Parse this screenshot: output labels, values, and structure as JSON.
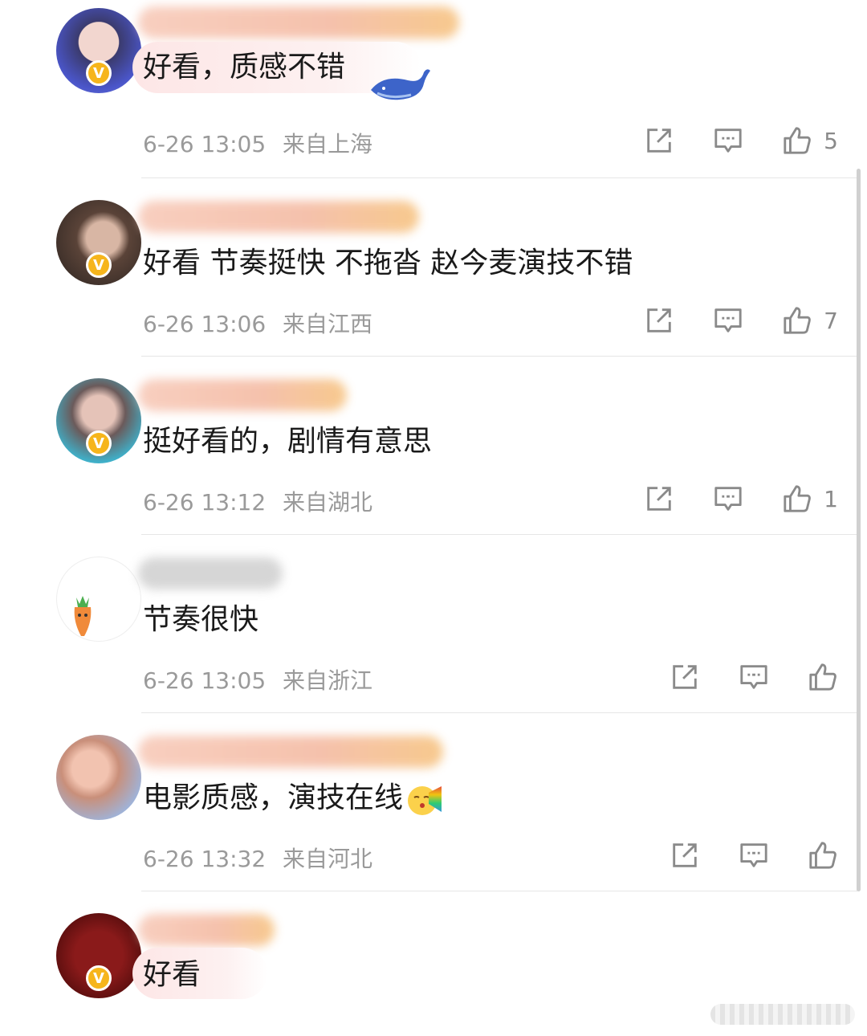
{
  "comments": [
    {
      "content": "好看，质感不错",
      "time": "6-26 13:05",
      "location": "来自上海",
      "likes": "5",
      "verified": "V"
    },
    {
      "content": "好看 节奏挺快 不拖沓 赵今麦演技不错",
      "time": "6-26 13:06",
      "location": "来自江西",
      "likes": "7",
      "verified": "V"
    },
    {
      "content": "挺好看的，剧情有意思",
      "time": "6-26 13:12",
      "location": "来自湖北",
      "likes": "1",
      "verified": "V"
    },
    {
      "content": "节奏很快",
      "time": "6-26 13:05",
      "location": "来自浙江",
      "likes": ""
    },
    {
      "content": "电影质感，演技在线",
      "time": "6-26 13:32",
      "location": "来自河北",
      "likes": "",
      "verified": ""
    },
    {
      "content": "好看",
      "verified": "V"
    }
  ],
  "icons": {
    "repost": "repost-icon",
    "comment": "comment-icon",
    "like": "thumbs-up-icon"
  },
  "colors": {
    "verified_badge": "#f6b51c",
    "meta_text": "#9a9a9a",
    "divider": "#e6e6e6"
  }
}
